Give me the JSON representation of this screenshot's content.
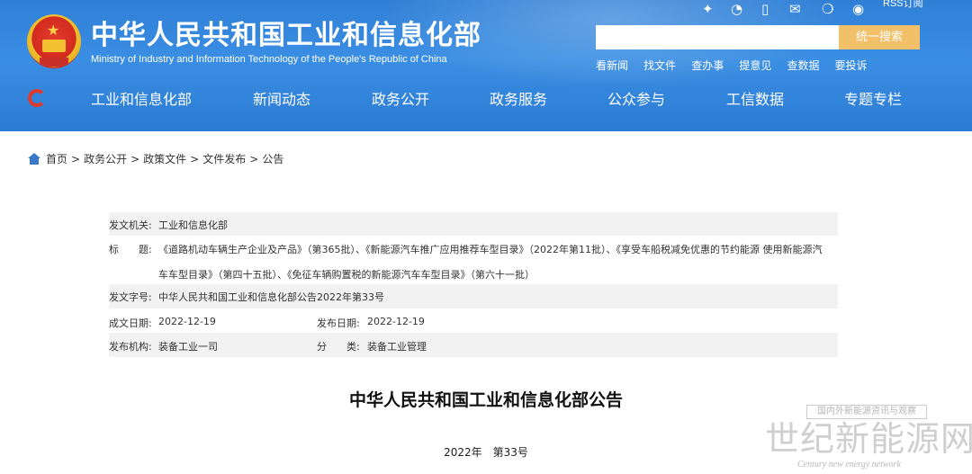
{
  "header": {
    "title_cn": "中华人民共和国工业和信息化部",
    "title_en": "Ministry of Industry and Information Technology of the People's Republic of China",
    "top_icons": [
      "weibo-icon",
      "app-icon",
      "mobile-icon",
      "mail-icon",
      "wechat-icon",
      "weibo-circle-icon"
    ],
    "rss_label": "RSS订阅",
    "search": {
      "placeholder": "",
      "button_label": "统一搜索"
    },
    "quick_links": [
      "看新闻",
      "找文件",
      "查办事",
      "提意见",
      "查数据",
      "要投诉"
    ],
    "nav": [
      "工业和信息化部",
      "新闻动态",
      "政务公开",
      "政务服务",
      "公众参与",
      "工信数据",
      "专题专栏"
    ],
    "colors": {
      "header_blue": "#2f7fd6",
      "search_button": "#f3c06a",
      "logo_red": "#e2392b"
    }
  },
  "breadcrumb": [
    "首页",
    "政务公开",
    "政策文件",
    "文件发布",
    "公告"
  ],
  "info": {
    "issuer_label": "发文机关:",
    "issuer": "工业和信息化部",
    "title_label": "标　　题:",
    "title_line1": "《道路机动车辆生产企业及产品》（第365批）、《新能源汽车推广应用推荐车型目录》（2022年第11批）、《享受车船税减免优惠的节约能源 使用新能源汽",
    "title_line2": "车车型目录》（第四十五批）、《免征车辆购置税的新能源汽车车型目录》（第六十一批）",
    "doc_no_label": "发文字号:",
    "doc_no": "中华人民共和国工业和信息化部公告2022年第33号",
    "created_label": "成文日期:",
    "created": "2022-12-19",
    "published_label": "发布日期:",
    "published": "2022-12-19",
    "org_label": "发布机构:",
    "org": "装备工业一司",
    "category_label": "分　　类:",
    "category": "装备工业管理"
  },
  "document": {
    "heading": "中华人民共和国工业和信息化部公告",
    "number": "2022年　第33号"
  },
  "watermark": {
    "tagline": "国内外新能源资讯与观察",
    "name_cn": "世纪新能源网",
    "name_en": "Century new energy network"
  }
}
